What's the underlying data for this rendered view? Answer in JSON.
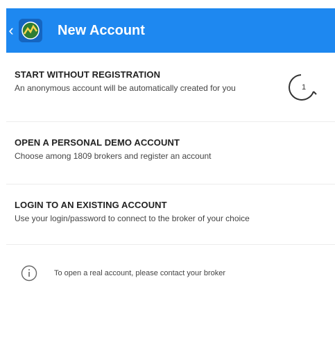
{
  "header": {
    "back_icon": "chevron-left-icon",
    "logo_icon": "metatrader-logo-icon",
    "title": "New Account",
    "color": "#1e88f0"
  },
  "options": [
    {
      "heading": "START WITHOUT REGISTRATION",
      "description": "An anonymous account will be automatically created for you",
      "spinner_value": "1"
    },
    {
      "heading": "OPEN A PERSONAL DEMO ACCOUNT",
      "description": "Choose among 1809 brokers and register an account"
    },
    {
      "heading": "LOGIN TO AN EXISTING ACCOUNT",
      "description": "Use your login/password to connect to the broker of your choice"
    }
  ],
  "note": {
    "icon": "info-icon",
    "text": "To open a real account, please contact your broker"
  }
}
